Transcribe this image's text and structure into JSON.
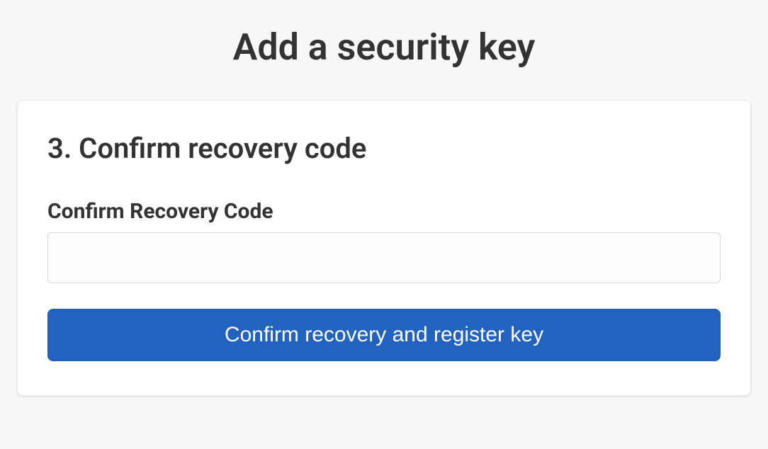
{
  "page": {
    "title": "Add a security key"
  },
  "step": {
    "heading": "3. Confirm recovery code",
    "field_label": "Confirm Recovery Code",
    "input_value": "",
    "button_label": "Confirm recovery and register key"
  }
}
